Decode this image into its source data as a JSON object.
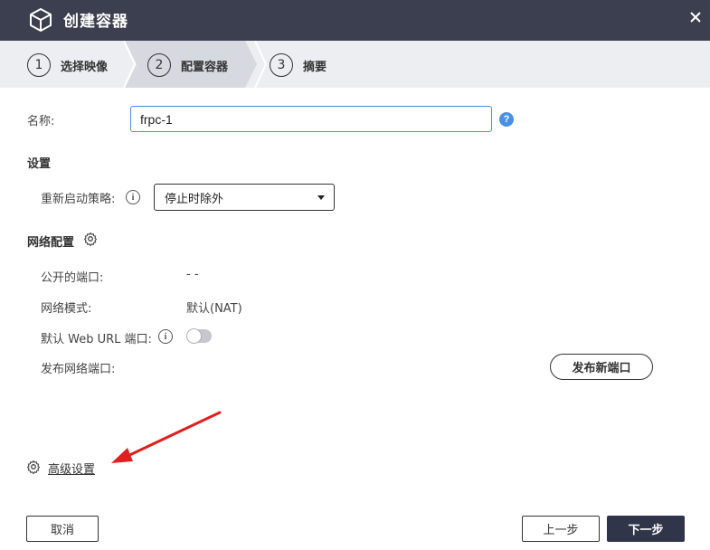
{
  "window": {
    "title": "创建容器",
    "icon": "cube-icon",
    "close_icon": "close-icon"
  },
  "steps": [
    {
      "number": "1",
      "label": "选择映像",
      "active": false
    },
    {
      "number": "2",
      "label": "配置容器",
      "active": true
    },
    {
      "number": "3",
      "label": "摘要",
      "active": false
    }
  ],
  "name_field": {
    "label": "名称:",
    "value": "frpc-1",
    "help_icon": "?"
  },
  "settings": {
    "title": "设置",
    "restart_policy_label": "重新启动策略:",
    "info_icon": "i",
    "restart_policy_value": "停止时除外"
  },
  "network": {
    "title": "网络配置",
    "public_ports_label": "公开的端口:",
    "public_ports_value": "- -",
    "mode_label": "网络模式:",
    "mode_value": "默认(NAT)",
    "web_url_port_label": "默认 Web URL 端口:",
    "web_url_port_enabled": false,
    "publish_ports_label": "发布网络端口:",
    "publish_new_port_button": "发布新端口"
  },
  "advanced_settings_link": "高级设置",
  "footer": {
    "cancel": "取消",
    "previous": "上一步",
    "next": "下一步"
  },
  "colors": {
    "titlebar": "#3c3f4f",
    "stepbar": "#eceef1",
    "active_step": "#d6d9df",
    "accent": "#4a90e2",
    "primary_button": "#31354a",
    "annotation_arrow": "#e02020"
  }
}
